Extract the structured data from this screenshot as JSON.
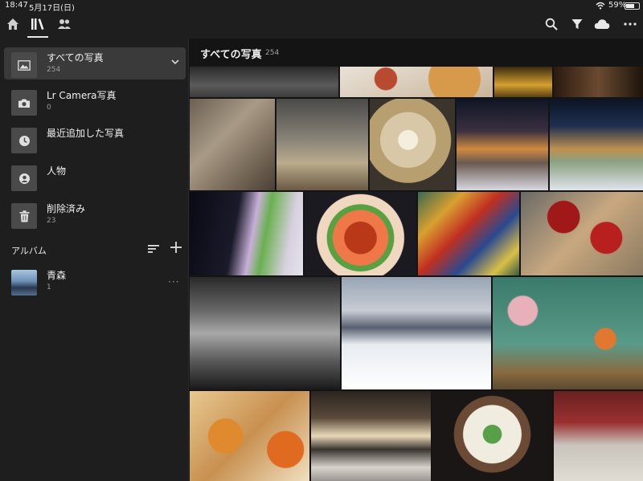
{
  "status_bar": {
    "time": "18:47",
    "date": "5月17日(日)",
    "battery": "59%"
  },
  "top_bar": {
    "left_icons": [
      "home-icon",
      "library-icon",
      "people-icon"
    ],
    "right_icons": [
      "search-icon",
      "filter-icon",
      "cloud-icon",
      "more-icon"
    ]
  },
  "sidebar": {
    "items": [
      {
        "label": "すべての写真",
        "count": "254",
        "icon": "photos-icon"
      },
      {
        "label": "Lr Camera写真",
        "count": "0",
        "icon": "camera-icon"
      },
      {
        "label": "最近追加した写真",
        "count": "",
        "icon": "clock-icon"
      },
      {
        "label": "人物",
        "count": "",
        "icon": "person-icon"
      },
      {
        "label": "削除済み",
        "count": "23",
        "icon": "trash-icon"
      }
    ],
    "albums_heading": "アルバム",
    "albums": [
      {
        "label": "青森",
        "count": "1",
        "more": "···"
      }
    ]
  },
  "main": {
    "title": "すべての写真",
    "count": "254"
  },
  "colors": {
    "background": "#141414",
    "sidebar": "#1e1e1e",
    "active_item": "#3a3a3a"
  }
}
